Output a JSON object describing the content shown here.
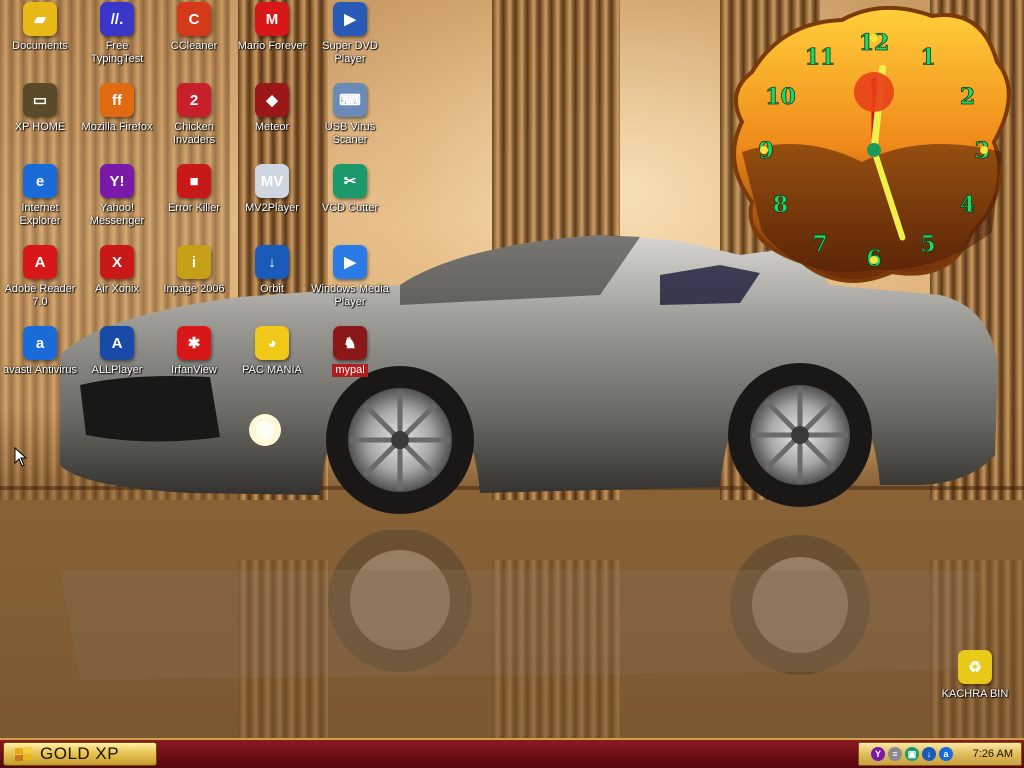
{
  "colors": {
    "taskbar": "#6b0c13",
    "start_button_gold": "#e9c556",
    "selected_label": "#b01e1e",
    "clock_numeral": "#1fd86a"
  },
  "desktop": {
    "icons": [
      {
        "label": "Documents",
        "icon": "folder-icon",
        "color": "#e8b818",
        "glyph": "▰"
      },
      {
        "label": "Free TypingTest",
        "icon": "typing-test-icon",
        "color": "#3a36c8",
        "glyph": "//."
      },
      {
        "label": "CCleaner",
        "icon": "ccleaner-icon",
        "color": "#d43a1a",
        "glyph": "C"
      },
      {
        "label": "Mario Forever",
        "icon": "mario-icon",
        "color": "#d81818",
        "glyph": "M"
      },
      {
        "label": "Super DVD Player",
        "icon": "dvd-player-icon",
        "color": "#2a5ab8",
        "glyph": "▶"
      },
      {
        "label": "XP HOME",
        "icon": "xp-home-icon",
        "color": "#5a4a2a",
        "glyph": "▭"
      },
      {
        "label": "Mozilla Firefox",
        "icon": "firefox-icon",
        "color": "#e06a12",
        "glyph": "ff"
      },
      {
        "label": "Chicken Invaders",
        "icon": "chicken-invaders-icon",
        "color": "#c8202a",
        "glyph": "2"
      },
      {
        "label": "Meteor",
        "icon": "meteor-icon",
        "color": "#9a1818",
        "glyph": "◆"
      },
      {
        "label": "USB Virus Scaner",
        "icon": "usb-scanner-icon",
        "color": "#6a8ab8",
        "glyph": "⌨"
      },
      {
        "label": "Internet Explorer",
        "icon": "internet-explorer-icon",
        "color": "#1a6ad8",
        "glyph": "e"
      },
      {
        "label": "Yahoo! Messenger",
        "icon": "yahoo-messenger-icon",
        "color": "#7a1aa8",
        "glyph": "Y!"
      },
      {
        "label": "Error Killer",
        "icon": "error-killer-icon",
        "color": "#c81818",
        "glyph": "■"
      },
      {
        "label": "MV2Player",
        "icon": "mv2player-icon",
        "color": "#cfd6e0",
        "glyph": "MV"
      },
      {
        "label": "VCD Cutter",
        "icon": "vcd-cutter-icon",
        "color": "#1a9a6a",
        "glyph": "✂"
      },
      {
        "label": "Adobe Reader 7.0",
        "icon": "adobe-reader-icon",
        "color": "#d81818",
        "glyph": "A"
      },
      {
        "label": "Air Xonix",
        "icon": "air-xonix-icon",
        "color": "#c81818",
        "glyph": "X"
      },
      {
        "label": "Inpage 2006",
        "icon": "inpage-icon",
        "color": "#c8a018",
        "glyph": "i"
      },
      {
        "label": "Orbit",
        "icon": "orbit-download-icon",
        "color": "#1a5ab8",
        "glyph": "↓"
      },
      {
        "label": "Windows Media Player",
        "icon": "windows-media-player-icon",
        "color": "#2a7ae8",
        "glyph": "▶"
      },
      {
        "label": "avast! Antivirus",
        "icon": "avast-icon",
        "color": "#1a6ad8",
        "glyph": "a"
      },
      {
        "label": "ALLPlayer",
        "icon": "allplayer-icon",
        "color": "#1a4aa8",
        "glyph": "A"
      },
      {
        "label": "IrfanView",
        "icon": "irfanview-icon",
        "color": "#d81818",
        "glyph": "✱"
      },
      {
        "label": "PAC MANIA",
        "icon": "pacmania-icon",
        "color": "#f0c818",
        "glyph": "◕"
      },
      {
        "label": "mypal",
        "icon": "mypal-icon",
        "color": "#8a1818",
        "glyph": "♞"
      },
      {
        "label": "KACHRA BIN",
        "icon": "recycle-bin-icon",
        "color": "#e8c818",
        "glyph": "♻"
      }
    ]
  },
  "clock_widget": {
    "numerals": [
      "12",
      "1",
      "2",
      "3",
      "4",
      "5",
      "6",
      "7",
      "8",
      "9",
      "10",
      "11"
    ],
    "hour": 12,
    "minute": 1,
    "second": 27
  },
  "taskbar": {
    "start_label": "GOLD XP",
    "tray_icons": [
      {
        "name": "yahoo-tray-icon",
        "color": "#7a1aa8",
        "glyph": "Y"
      },
      {
        "name": "network-tray-icon",
        "color": "#8a8a8a",
        "glyph": "≡"
      },
      {
        "name": "vcd-tray-icon",
        "color": "#1a9a6a",
        "glyph": "▣"
      },
      {
        "name": "orbit-tray-icon",
        "color": "#1a5ab8",
        "glyph": "↓"
      },
      {
        "name": "avast-tray-icon",
        "color": "#1a6ad8",
        "glyph": "a"
      }
    ],
    "time": "7:26 AM"
  }
}
